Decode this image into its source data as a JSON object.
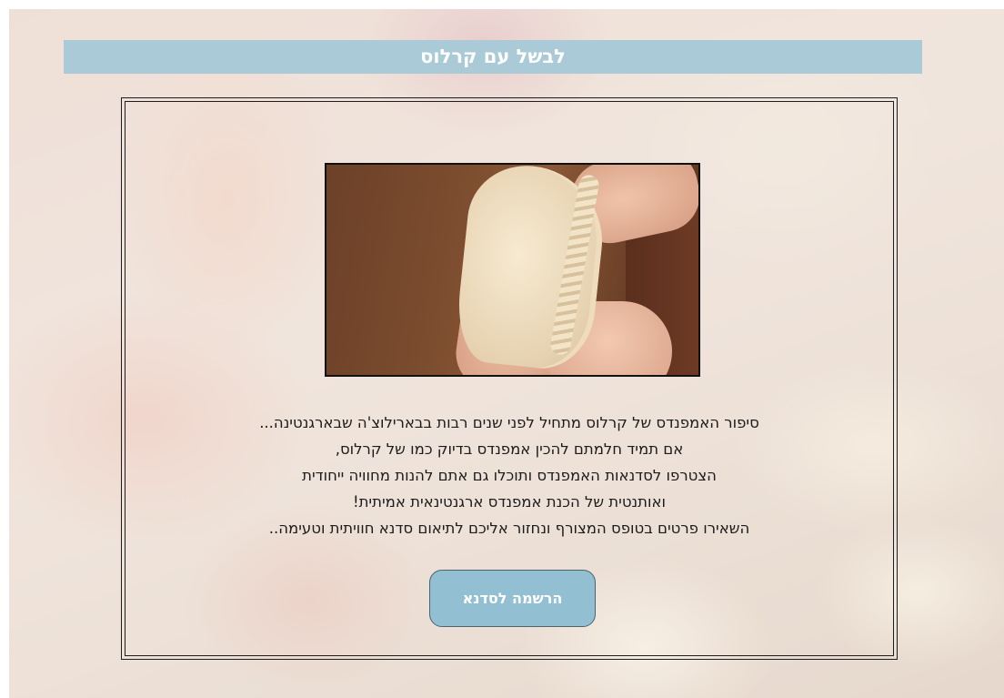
{
  "header": {
    "title": "לבשל עם קרלוס"
  },
  "photo": {
    "alt": "empanada-dough-in-hands"
  },
  "story": {
    "lines": [
      "סיפור האמפנדס של קרלוס מתחיל לפני שנים רבות בבארילוצ'ה שבארגנטינה...",
      "אם תמיד חלמתם להכין אמפנדס בדיוק כמו של קרלוס,",
      "הצטרפו לסדנאות האמפנדס ותוכלו גם אתם להנות מחוויה ייחודית",
      "ואותנטית של הכנת אמפנדס ארגנטינאית אמיתית!",
      "השאירו פרטים בטופס המצורף ונחזור אליכם לתיאום סדנא חוויתית וטעימה.."
    ]
  },
  "cta": {
    "label": "הרשמה לסדנא"
  },
  "colors": {
    "title_bar": "#a9cad6",
    "button_bg": "#93bfd3",
    "frame_border": "#1e1e1e"
  }
}
